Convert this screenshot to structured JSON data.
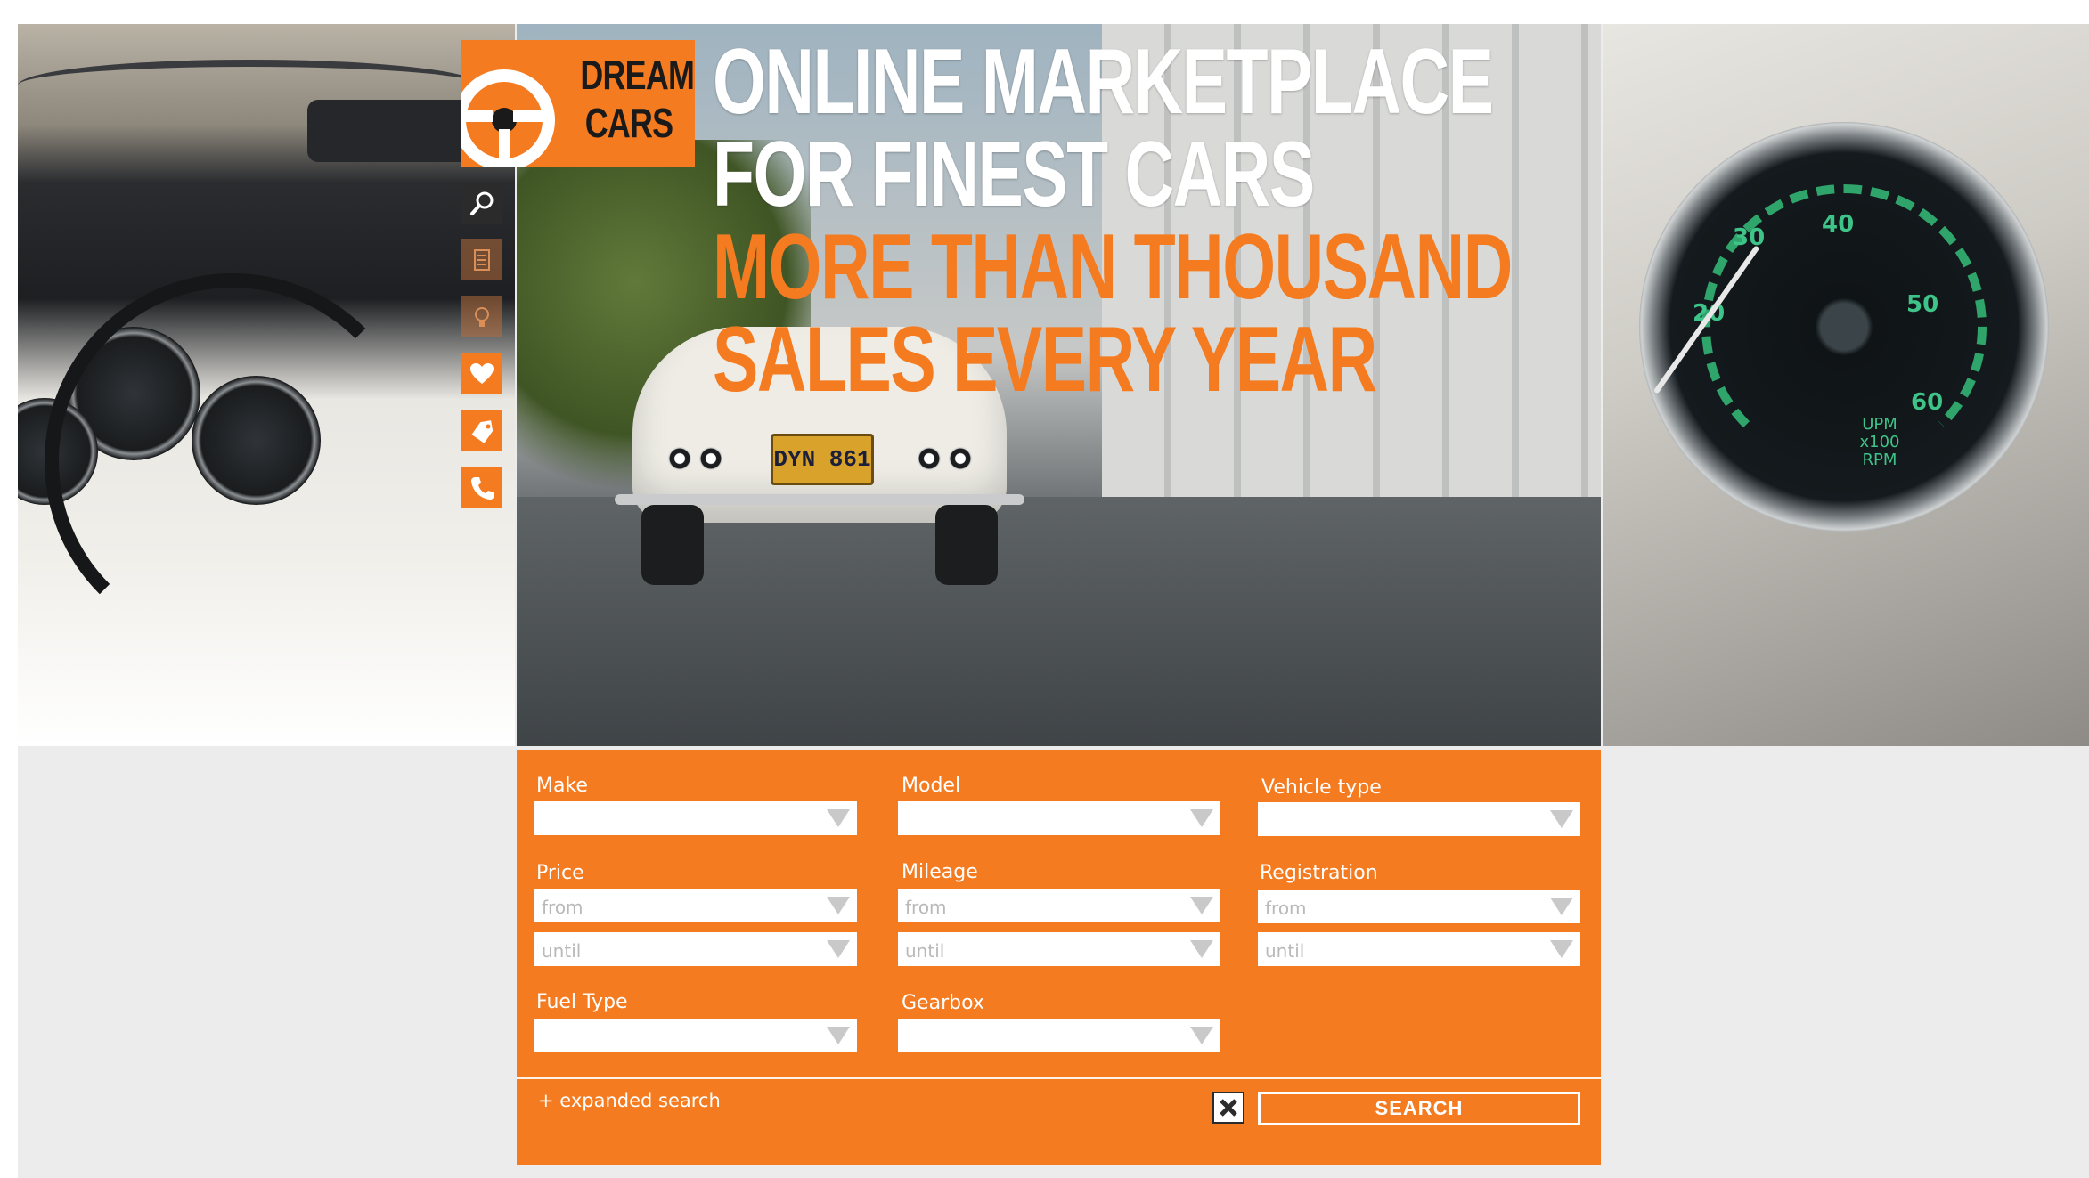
{
  "brand": {
    "logo_line1": "DREAM",
    "logo_line2": "CARS",
    "accent": "#f47b20"
  },
  "headline": {
    "line1": "ONLINE MARKETPLACE",
    "line2": "FOR FINEST CARS",
    "line3": "MORE THAN THOUSAND",
    "line4": "SALES EVERY YEAR"
  },
  "sidebar": {
    "items": [
      {
        "icon": "search-icon"
      },
      {
        "icon": "document-icon"
      },
      {
        "icon": "lightbulb-icon"
      },
      {
        "icon": "heart-icon"
      },
      {
        "icon": "tag-icon"
      },
      {
        "icon": "phone-icon"
      }
    ]
  },
  "hero": {
    "plate_text": "DYN 861",
    "speedo_units": "UPM x100 RPM"
  },
  "search_form": {
    "make_label": "Make",
    "model_label": "Model",
    "vehicle_type_label": "Vehicle type",
    "price_label": "Price",
    "mileage_label": "Mileage",
    "registration_label": "Registration",
    "fuel_type_label": "Fuel Type",
    "gearbox_label": "Gearbox",
    "from_placeholder": "from",
    "until_placeholder": "until",
    "expanded_search": "+ expanded search",
    "search_button": "SEARCH"
  }
}
